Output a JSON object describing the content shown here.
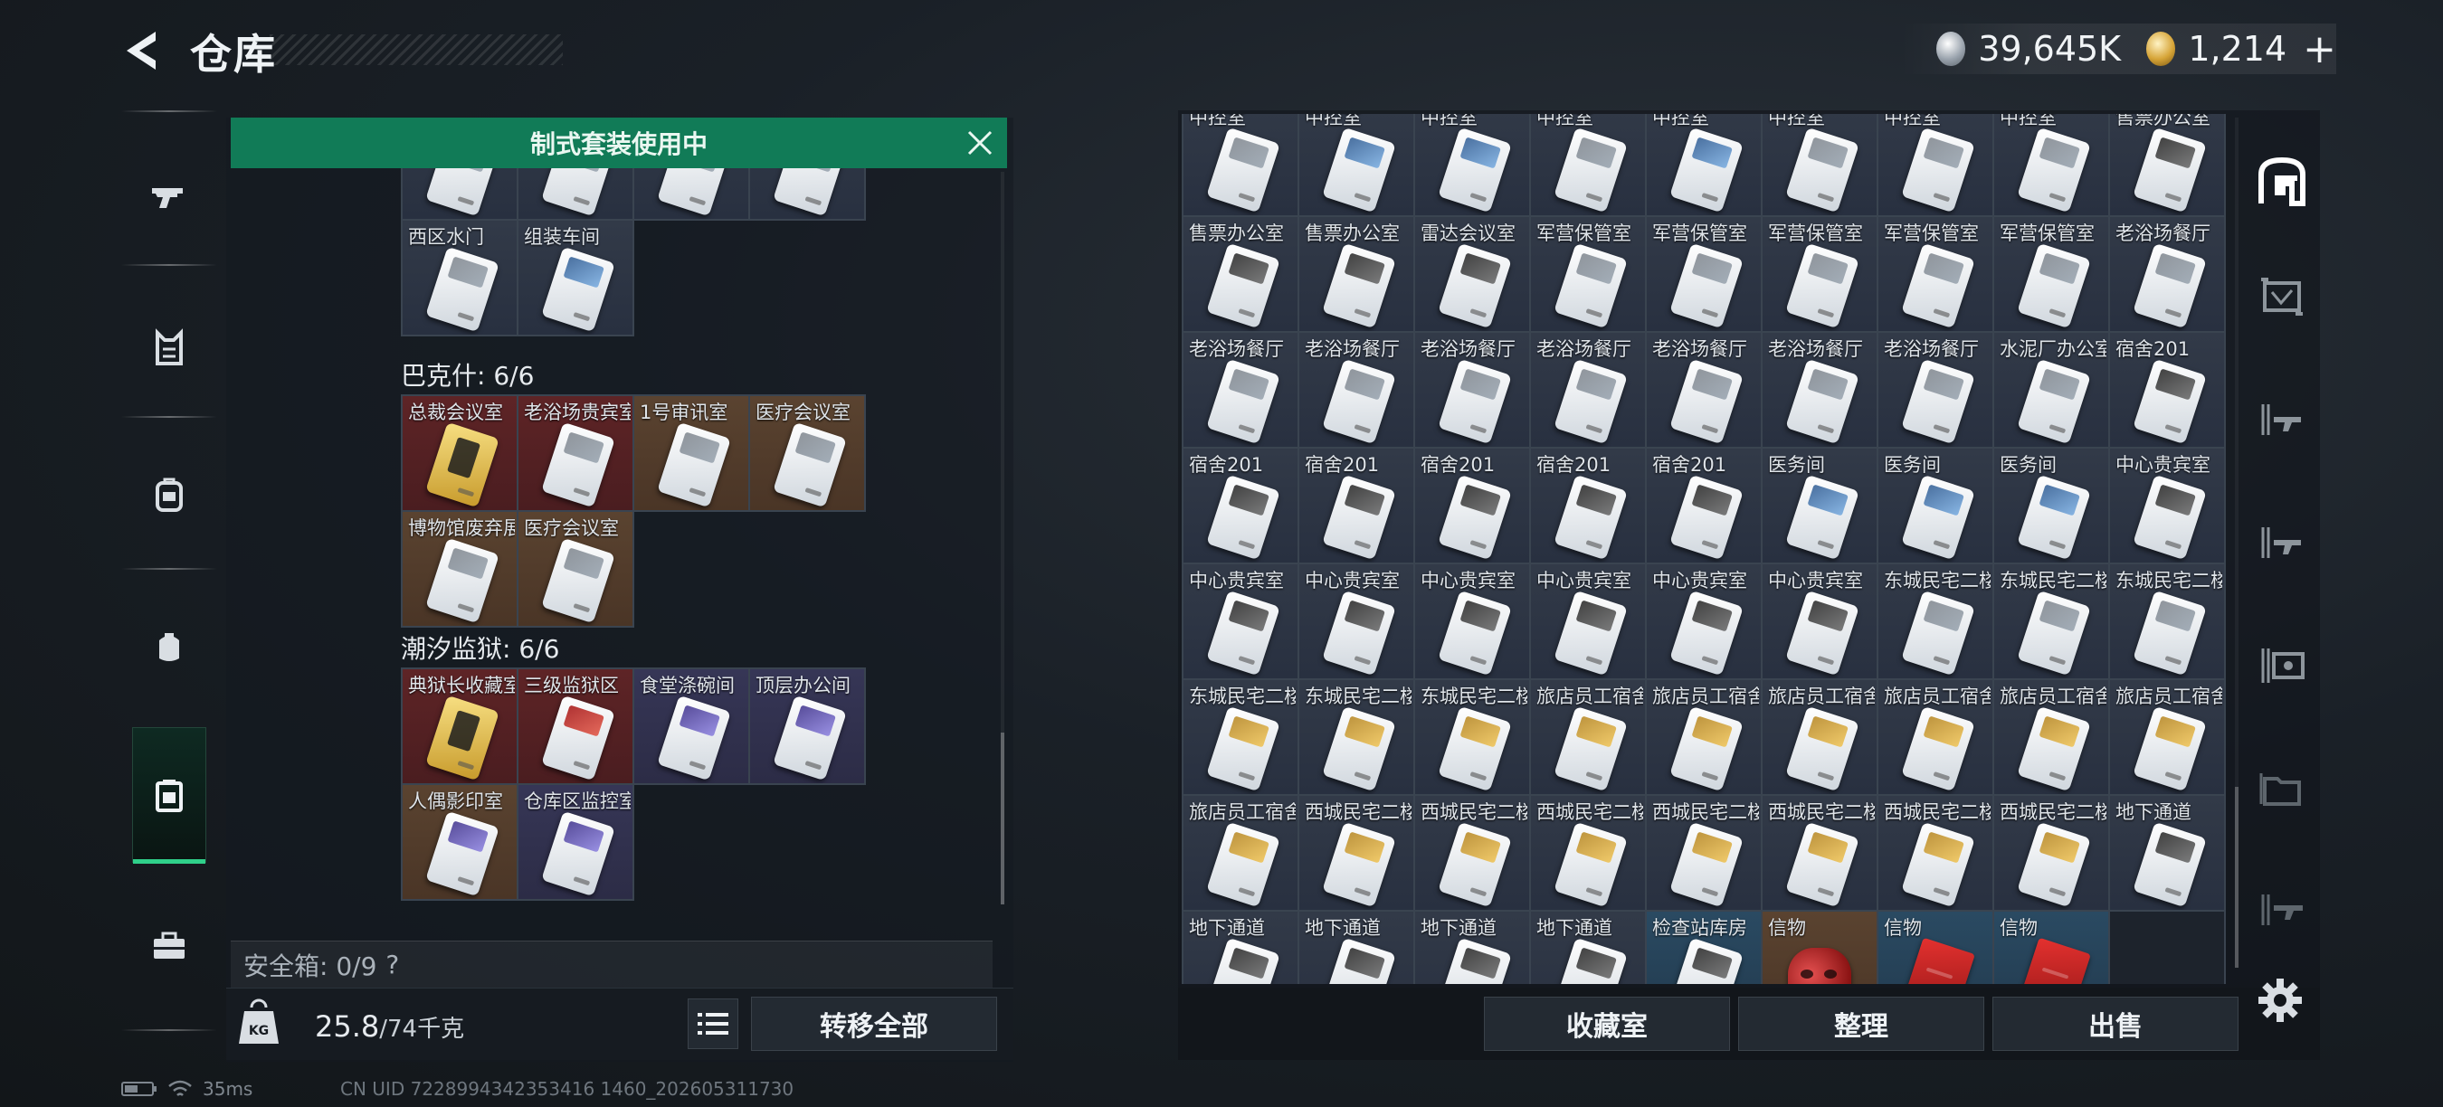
{
  "header": {
    "title": "仓库"
  },
  "currency": [
    {
      "icon": "silver-coin-icon",
      "value": "39,645K"
    },
    {
      "icon": "gold-coin-icon",
      "value": "1,214"
    }
  ],
  "currency_plus": "+",
  "left_rail": [
    {
      "icon": "gun-icon"
    },
    {
      "icon": "vest-icon"
    },
    {
      "icon": "backpack-icon"
    },
    {
      "icon": "pouch-icon"
    },
    {
      "icon": "keycard-case-icon",
      "active": true
    },
    {
      "icon": "toolbox-icon"
    }
  ],
  "banner": {
    "text": "制式套装使用中"
  },
  "left_panel": {
    "top_row": [
      "",
      "",
      "",
      ""
    ],
    "row2": [
      {
        "label": "西区水门",
        "rarity": "gray",
        "card": ""
      },
      {
        "label": "组装车间",
        "rarity": "gray",
        "card": "cblue"
      }
    ],
    "sections": [
      {
        "title": "巴克什: 6/6",
        "items": [
          {
            "label": "总裁会议室",
            "rarity": "red",
            "card": "goldcard"
          },
          {
            "label": "老浴场贵宾室",
            "rarity": "red",
            "card": ""
          },
          {
            "label": "1号审讯室",
            "rarity": "gold",
            "card": ""
          },
          {
            "label": "医疗会议室",
            "rarity": "gold",
            "card": ""
          },
          {
            "label": "博物馆废弃展厅",
            "rarity": "gold",
            "card": ""
          },
          {
            "label": "医疗会议室",
            "rarity": "gold",
            "card": ""
          }
        ]
      },
      {
        "title": "潮汐监狱: 6/6",
        "items": [
          {
            "label": "典狱长收藏室",
            "rarity": "red",
            "card": "goldcard"
          },
          {
            "label": "三级监狱区",
            "rarity": "red",
            "card": "cred"
          },
          {
            "label": "食堂涤碗间",
            "rarity": "purple",
            "card": "cpurple"
          },
          {
            "label": "顶层办公间",
            "rarity": "purple",
            "card": "cpurple"
          },
          {
            "label": "人偶影印室",
            "rarity": "gold",
            "card": "cpurple"
          },
          {
            "label": "仓库区监控室",
            "rarity": "purple",
            "card": "cpurple"
          }
        ]
      }
    ],
    "safebox": {
      "label": "安全箱: 0/9",
      "help": "?"
    },
    "weight_icon_text": "KG",
    "weight": {
      "current": "25.8",
      "max": "/74千克"
    },
    "transfer_all": "转移全部"
  },
  "status": {
    "latency": "35ms",
    "uid": "CN UID 7228994342353416 1460_202605311730"
  },
  "right_grid": [
    {
      "label": "中控室",
      "rarity": "gray",
      "card": ""
    },
    {
      "label": "中控室",
      "rarity": "gray",
      "card": "cblue"
    },
    {
      "label": "中控室",
      "rarity": "gray",
      "card": "cblue"
    },
    {
      "label": "中控室",
      "rarity": "gray",
      "card": ""
    },
    {
      "label": "中控室",
      "rarity": "gray",
      "card": "cblue"
    },
    {
      "label": "中控室",
      "rarity": "gray",
      "card": ""
    },
    {
      "label": "中控室",
      "rarity": "gray",
      "card": ""
    },
    {
      "label": "中控室",
      "rarity": "gray",
      "card": ""
    },
    {
      "label": "售票办公室",
      "rarity": "gray",
      "card": "cdark"
    },
    {
      "label": "售票办公室",
      "rarity": "gray",
      "card": "cdark"
    },
    {
      "label": "售票办公室",
      "rarity": "gray",
      "card": "cdark"
    },
    {
      "label": "雷达会议室",
      "rarity": "gray",
      "card": "cdark"
    },
    {
      "label": "军营保管室",
      "rarity": "gray",
      "card": ""
    },
    {
      "label": "军营保管室",
      "rarity": "gray",
      "card": ""
    },
    {
      "label": "军营保管室",
      "rarity": "gray",
      "card": ""
    },
    {
      "label": "军营保管室",
      "rarity": "gray",
      "card": ""
    },
    {
      "label": "军营保管室",
      "rarity": "gray",
      "card": ""
    },
    {
      "label": "老浴场餐厅",
      "rarity": "gray",
      "card": ""
    },
    {
      "label": "老浴场餐厅",
      "rarity": "gray",
      "card": ""
    },
    {
      "label": "老浴场餐厅",
      "rarity": "gray",
      "card": ""
    },
    {
      "label": "老浴场餐厅",
      "rarity": "gray",
      "card": ""
    },
    {
      "label": "老浴场餐厅",
      "rarity": "gray",
      "card": ""
    },
    {
      "label": "老浴场餐厅",
      "rarity": "gray",
      "card": ""
    },
    {
      "label": "老浴场餐厅",
      "rarity": "gray",
      "card": ""
    },
    {
      "label": "老浴场餐厅",
      "rarity": "gray",
      "card": ""
    },
    {
      "label": "水泥厂办公室",
      "rarity": "gray",
      "card": ""
    },
    {
      "label": "宿舍201",
      "rarity": "gray",
      "card": "cdark"
    },
    {
      "label": "宿舍201",
      "rarity": "gray",
      "card": "cdark"
    },
    {
      "label": "宿舍201",
      "rarity": "gray",
      "card": "cdark"
    },
    {
      "label": "宿舍201",
      "rarity": "gray",
      "card": "cdark"
    },
    {
      "label": "宿舍201",
      "rarity": "gray",
      "card": "cdark"
    },
    {
      "label": "宿舍201",
      "rarity": "gray",
      "card": "cdark"
    },
    {
      "label": "医务间",
      "rarity": "gray",
      "card": "cblue"
    },
    {
      "label": "医务间",
      "rarity": "gray",
      "card": "cblue"
    },
    {
      "label": "医务间",
      "rarity": "gray",
      "card": "cblue"
    },
    {
      "label": "中心贵宾室",
      "rarity": "gray",
      "card": "cdark"
    },
    {
      "label": "中心贵宾室",
      "rarity": "gray",
      "card": "cdark"
    },
    {
      "label": "中心贵宾室",
      "rarity": "gray",
      "card": "cdark"
    },
    {
      "label": "中心贵宾室",
      "rarity": "gray",
      "card": "cdark"
    },
    {
      "label": "中心贵宾室",
      "rarity": "gray",
      "card": "cdark"
    },
    {
      "label": "中心贵宾室",
      "rarity": "gray",
      "card": "cdark"
    },
    {
      "label": "中心贵宾室",
      "rarity": "gray",
      "card": "cdark"
    },
    {
      "label": "东城民宅二楼",
      "rarity": "gray",
      "card": ""
    },
    {
      "label": "东城民宅二楼",
      "rarity": "gray",
      "card": ""
    },
    {
      "label": "东城民宅二楼",
      "rarity": "gray",
      "card": ""
    },
    {
      "label": "东城民宅二楼",
      "rarity": "gray",
      "card": "cgold"
    },
    {
      "label": "东城民宅二楼",
      "rarity": "gray",
      "card": "cgold"
    },
    {
      "label": "东城民宅二楼",
      "rarity": "gray",
      "card": "cgold"
    },
    {
      "label": "旅店员工宿舍",
      "rarity": "gray",
      "card": "cgold"
    },
    {
      "label": "旅店员工宿舍",
      "rarity": "gray",
      "card": "cgold"
    },
    {
      "label": "旅店员工宿舍",
      "rarity": "gray",
      "card": "cgold"
    },
    {
      "label": "旅店员工宿舍",
      "rarity": "gray",
      "card": "cgold"
    },
    {
      "label": "旅店员工宿舍",
      "rarity": "gray",
      "card": "cgold"
    },
    {
      "label": "旅店员工宿舍",
      "rarity": "gray",
      "card": "cgold"
    },
    {
      "label": "旅店员工宿舍",
      "rarity": "gray",
      "card": "cgold"
    },
    {
      "label": "西城民宅二楼",
      "rarity": "gray",
      "card": "cgold"
    },
    {
      "label": "西城民宅二楼",
      "rarity": "gray",
      "card": "cgold"
    },
    {
      "label": "西城民宅二楼",
      "rarity": "gray",
      "card": "cgold"
    },
    {
      "label": "西城民宅二楼",
      "rarity": "gray",
      "card": "cgold"
    },
    {
      "label": "西城民宅二楼",
      "rarity": "gray",
      "card": "cgold"
    },
    {
      "label": "西城民宅二楼",
      "rarity": "gray",
      "card": "cgold"
    },
    {
      "label": "西城民宅二楼",
      "rarity": "gray",
      "card": "cgold"
    },
    {
      "label": "地下通道",
      "rarity": "gray",
      "card": "cdark"
    },
    {
      "label": "地下通道",
      "rarity": "gray",
      "card": "cdark"
    },
    {
      "label": "地下通道",
      "rarity": "gray",
      "card": "cdark"
    },
    {
      "label": "地下通道",
      "rarity": "gray",
      "card": "cdark"
    },
    {
      "label": "地下通道",
      "rarity": "gray",
      "card": "cdark"
    },
    {
      "label": "检查站库房",
      "rarity": "blue",
      "card": "cdark"
    },
    {
      "label": "信物",
      "rarity": "gold",
      "card": "mask"
    },
    {
      "label": "信物",
      "rarity": "blue",
      "card": "redbook"
    },
    {
      "label": "信物",
      "rarity": "blue",
      "card": "redbook"
    },
    {
      "label": "",
      "rarity": "empty",
      "card": "none"
    }
  ],
  "right_buttons": [
    "收藏室",
    "整理",
    "出售"
  ],
  "right_rail": [
    {
      "icon": "home-base-icon",
      "active": true
    },
    {
      "icon": "box-crate-icon"
    },
    {
      "icon": "weapon-rack-icon"
    },
    {
      "icon": "weapon-rack-2-icon"
    },
    {
      "icon": "safe-deposit-icon"
    },
    {
      "icon": "file-folder-icon"
    },
    {
      "icon": "rifle-case-icon"
    }
  ],
  "colors": {
    "accent_green": "#117b57",
    "active_bar": "#2fd08a"
  }
}
